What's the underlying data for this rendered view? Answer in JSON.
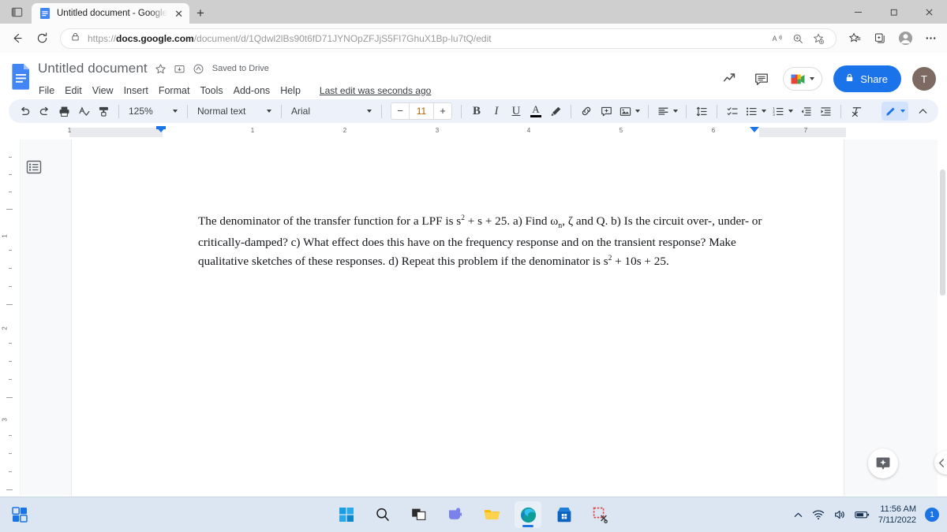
{
  "browser": {
    "tab": {
      "title": "Untitled document - Google Doc",
      "favicon_name": "google-docs-favicon",
      "close_label": "✕"
    },
    "newtab_label": "+",
    "window_controls": {
      "minimize": "—",
      "maximize": "❐",
      "close": "✕"
    },
    "url": {
      "scheme": "https://",
      "host": "docs.google.com",
      "path": "/document/d/1Qdwl2lBs90t6fD71JYNOpZFJjS5FI7GhuX1Bp-lu7tQ/edit",
      "full": "https://docs.google.com/document/d/1Qdwl2lBs90t6fD71JYNOpZFJjS5FI7GhuX1Bp-lu7tQ/edit"
    },
    "nav_icons": [
      "back-icon",
      "refresh-icon"
    ],
    "omnibox_icons": [
      "read-aloud-icon",
      "zoom-icon",
      "add-favorite-icon"
    ],
    "toolbar_icons": [
      "favorites-icon",
      "collections-icon",
      "profile-icon",
      "settings-more-icon"
    ]
  },
  "docs": {
    "title": "Untitled document",
    "save_status": "Saved to Drive",
    "menu": [
      "File",
      "Edit",
      "View",
      "Insert",
      "Format",
      "Tools",
      "Add-ons",
      "Help"
    ],
    "last_edit": "Last edit was seconds ago",
    "share_label": "Share",
    "avatar_initial": "T",
    "toolbar": {
      "zoom": "125%",
      "paragraph_style": "Normal text",
      "font": "Arial",
      "font_size": "11",
      "font_size_decrease": "−",
      "font_size_increase": "+",
      "bold": "B",
      "italic": "I",
      "underline": "U",
      "text_color": "A",
      "icons": [
        "undo-icon",
        "redo-icon",
        "print-icon",
        "spellcheck-icon",
        "paint-format-icon",
        "highlight-color-icon",
        "insert-link-icon",
        "add-comment-icon",
        "insert-image-icon",
        "align-icon",
        "line-spacing-icon",
        "checklist-icon",
        "bulleted-list-icon",
        "numbered-list-icon",
        "decrease-indent-icon",
        "increase-indent-icon",
        "clear-formatting-icon",
        "editing-mode-pen-icon",
        "hide-menus-icon"
      ]
    },
    "ruler": {
      "h_numbers": [
        "1",
        "1",
        "2",
        "3",
        "4",
        "5",
        "6",
        "7"
      ],
      "v_numbers": [
        "1",
        "2",
        "3"
      ]
    },
    "body_text_parts": {
      "p1": "The denominator of the transfer function for a LPF is s",
      "sup1": "2",
      "p2": " + s + 25.  a) Find ω",
      "sub1": "n",
      "p3": ", ζ and Q.  b) Is the circuit over-, under- or critically-damped?  c) What effect does this have on the frequency response and on the transient response?  Make qualitative sketches of these responses.  d) Repeat this problem if the denominator is s",
      "sup2": "2",
      "p4": " + 10s + 25."
    },
    "body_text_plain": "The denominator of the transfer function for a LPF is s2 + s + 25.  a) Find ωn, ζ and Q.  b) Is the circuit over-, under- or critically-damped?  c) What effect does this have on the frequency response and on the transient response?  Make qualitative sketches of these responses.  d) Repeat this problem if the denominator is s2 + 10s + 25.",
    "outline_icon": "document-outline-icon",
    "explore_icon": "explore-icon",
    "collapse_icon": "collapse-chevron-icon"
  },
  "taskbar": {
    "apps": [
      "start-icon",
      "search-icon",
      "task-view-icon",
      "teams-icon",
      "file-explorer-icon",
      "edge-icon",
      "microsoft-store-icon",
      "snipping-tool-icon"
    ],
    "tray": {
      "overflow": "show-hidden-icons-chevron",
      "network": "wifi-icon",
      "volume": "volume-icon",
      "battery": "battery-icon",
      "time": "11:56 AM",
      "date": "7/11/2022",
      "notification_count": "1"
    },
    "left_icon": "widgets-icon"
  },
  "colors": {
    "accent_blue": "#1a73e8",
    "toolbar_bg": "#edf2fa",
    "taskbar_bg": "#dce6f2",
    "canvas_bg": "#f8f9fa"
  }
}
